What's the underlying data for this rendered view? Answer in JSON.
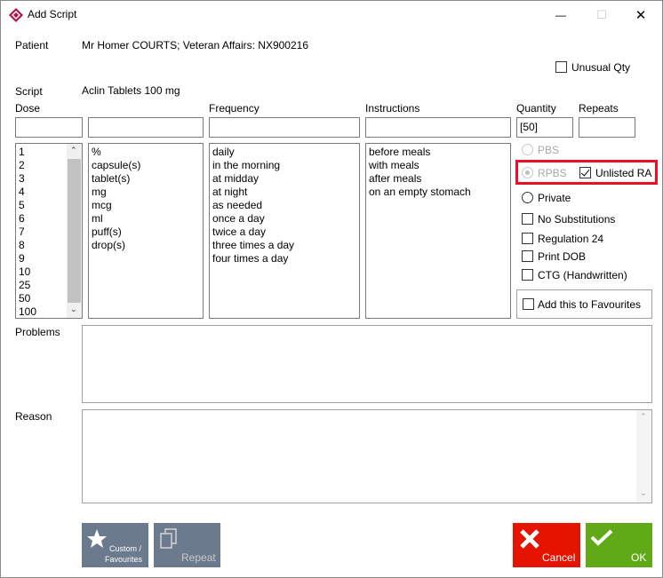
{
  "window": {
    "title": "Add Script",
    "min_symbol": "—",
    "max_symbol": "☐",
    "close_symbol": "✕"
  },
  "patient": {
    "label": "Patient",
    "value": "Mr Homer COURTS; Veteran Affairs: NX900216"
  },
  "unusual_qty": {
    "label": "Unusual Qty",
    "checked": false
  },
  "script": {
    "label": "Script",
    "value": "Aclin Tablets  100 mg"
  },
  "columns": {
    "dose": "Dose",
    "frequency": "Frequency",
    "instructions": "Instructions",
    "quantity": "Quantity",
    "repeats": "Repeats"
  },
  "inputs": {
    "dose_value": "",
    "unit_value": "",
    "frequency_value": "",
    "instructions_value": "",
    "quantity_value": "[50]",
    "repeats_value": ""
  },
  "lists": {
    "dose": [
      "1",
      "2",
      "3",
      "4",
      "5",
      "6",
      "7",
      "8",
      "9",
      "10",
      "25",
      "50",
      "100"
    ],
    "units": [
      "%",
      "capsule(s)",
      "tablet(s)",
      "mg",
      "mcg",
      "ml",
      "puff(s)",
      "drop(s)"
    ],
    "frequency": [
      "daily",
      "in the morning",
      "at midday",
      "at night",
      "as needed",
      "once a day",
      "twice a day",
      "three times a day",
      "four times a day"
    ],
    "instructions": [
      "before meals",
      "with meals",
      "after meals",
      "on an empty stomach"
    ]
  },
  "options": {
    "pbs": "PBS",
    "rpbs": "RPBS",
    "unlisted_ra": "Unlisted RA",
    "private": "Private",
    "no_substitutions": "No Substitutions",
    "regulation_24": "Regulation 24",
    "print_dob": "Print DOB",
    "ctg": "CTG (Handwritten)",
    "add_favourites": "Add this to Favourites"
  },
  "sections": {
    "problems": "Problems",
    "reason": "Reason"
  },
  "buttons": {
    "custom_favourites_line1": "Custom /",
    "custom_favourites_line2": "Favourites",
    "repeat": "Repeat",
    "cancel": "Cancel",
    "ok": "OK"
  },
  "colors": {
    "highlight_red": "#e81123",
    "tile_gray": "#6b7a8c",
    "cancel_red": "#e51400",
    "ok_green": "#60a917"
  },
  "icons": {
    "app": "app-logo-icon",
    "custom": "star-icon",
    "repeat": "copy-documents-icon",
    "cancel": "x-mark-icon",
    "ok": "checkmark-icon"
  }
}
